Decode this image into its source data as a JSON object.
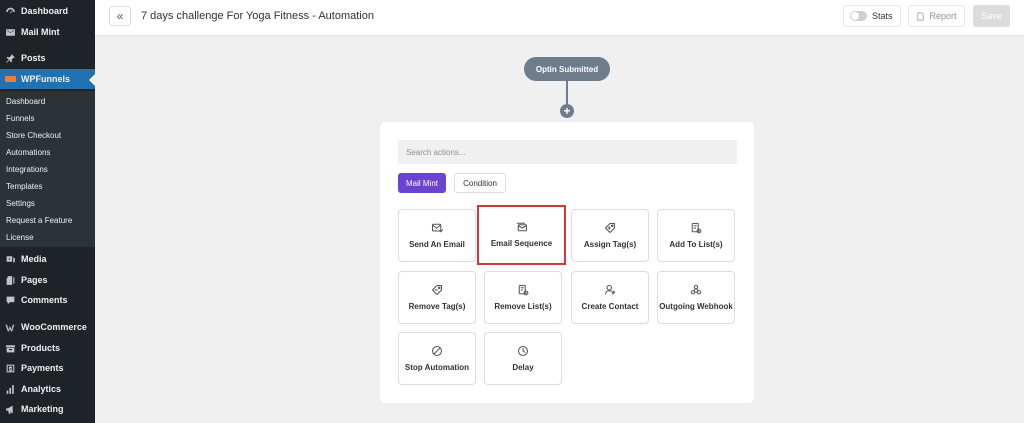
{
  "sidebar": {
    "items": [
      {
        "label": "Dashboard",
        "icon": "dashboard-icon"
      },
      {
        "label": "Mail Mint",
        "icon": "mail-icon"
      },
      {
        "label": "Posts",
        "icon": "pin-icon"
      },
      {
        "label": "WPFunnels",
        "icon": "wpfunnels-logo-icon"
      },
      {
        "label": "Media",
        "icon": "media-icon"
      },
      {
        "label": "Pages",
        "icon": "pages-icon"
      },
      {
        "label": "Comments",
        "icon": "comments-icon"
      },
      {
        "label": "WooCommerce",
        "icon": "woocommerce-icon"
      },
      {
        "label": "Products",
        "icon": "products-icon"
      },
      {
        "label": "Payments",
        "icon": "payments-icon"
      },
      {
        "label": "Analytics",
        "icon": "analytics-icon"
      },
      {
        "label": "Marketing",
        "icon": "marketing-icon"
      }
    ],
    "submenu": [
      "Dashboard",
      "Funnels",
      "Store Checkout",
      "Automations",
      "Integrations",
      "Templates",
      "Settings",
      "Request a Feature",
      "License"
    ]
  },
  "header": {
    "title": "7 days challenge For Yoga Fitness - Automation",
    "stats_label": "Stats",
    "report_label": "Report",
    "save_label": "Save"
  },
  "canvas": {
    "trigger_label": "Optin Submitted",
    "search_placeholder": "Search actions...",
    "tabs": [
      "Mail Mint",
      "Condition"
    ],
    "actions": [
      {
        "label": "Send An Email",
        "icon": "email-send-icon"
      },
      {
        "label": "Email Sequence",
        "icon": "email-sequence-icon"
      },
      {
        "label": "Assign Tag(s)",
        "icon": "tag-add-icon"
      },
      {
        "label": "Add To List(s)",
        "icon": "list-add-icon"
      },
      {
        "label": "Remove Tag(s)",
        "icon": "tag-remove-icon"
      },
      {
        "label": "Remove List(s)",
        "icon": "list-remove-icon"
      },
      {
        "label": "Create Contact",
        "icon": "user-add-icon"
      },
      {
        "label": "Outgoing Webhook",
        "icon": "webhook-icon"
      },
      {
        "label": "Stop Automation",
        "icon": "stop-icon"
      },
      {
        "label": "Delay",
        "icon": "clock-icon"
      }
    ]
  },
  "colors": {
    "sidebar_bg": "#1d2327",
    "active_menu": "#2271b1",
    "accent_purple": "#6a43d2",
    "trigger_bg": "#6e7d8c",
    "highlight_border": "#d63638"
  }
}
